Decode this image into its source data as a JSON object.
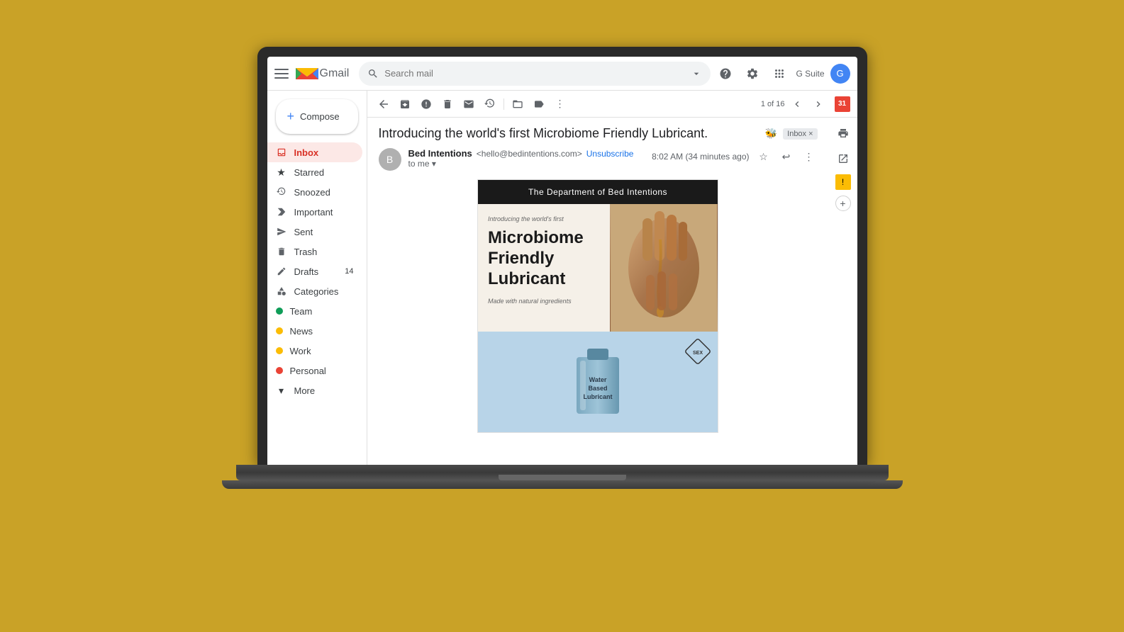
{
  "background_color": "#C9A227",
  "gmail": {
    "logo_text": "Gmail",
    "search_placeholder": "Search mail",
    "compose_label": "Compose",
    "pagination": "1 of 16",
    "gsuite_label": "G Suite",
    "sidebar": {
      "items": [
        {
          "label": "Inbox",
          "icon": "inbox",
          "active": true
        },
        {
          "label": "Starred",
          "icon": "star"
        },
        {
          "label": "Snoozed",
          "icon": "snooze"
        },
        {
          "label": "Important",
          "icon": "important"
        },
        {
          "label": "Sent",
          "icon": "sent"
        },
        {
          "label": "Trash",
          "icon": "trash"
        },
        {
          "label": "Drafts",
          "icon": "drafts",
          "badge": "14"
        },
        {
          "label": "Categories",
          "icon": "category"
        },
        {
          "label": "Team",
          "icon": "label",
          "color": "#0f9d58"
        },
        {
          "label": "News",
          "icon": "label",
          "color": "#fbbc04"
        },
        {
          "label": "Work",
          "icon": "label",
          "color": "#fbbc04"
        },
        {
          "label": "Personal",
          "icon": "label",
          "color": "#ea4335"
        },
        {
          "label": "More",
          "icon": "more"
        }
      ]
    },
    "email": {
      "subject": "Introducing the world's first Microbiome Friendly Lubricant.",
      "sender_name": "Bed Intentions",
      "sender_email": "<hello@bedintentions.com>",
      "unsubscribe": "Unsubscribe",
      "to_me": "to me",
      "time": "8:02 AM (34 minutes ago)",
      "newsletter": {
        "header": "The Department of Bed Intentions",
        "intro_text": "Introducing the world's first",
        "main_heading_line1": "Microbiome",
        "main_heading_line2": "Friendly",
        "main_heading_line3": "Lubricant",
        "made_with": "Made with natural ingredients",
        "product_badge": "SEX",
        "section2_heading_line1": "Water",
        "section2_heading_line2": "Based",
        "section2_heading_line3": "Lubricant"
      }
    }
  }
}
